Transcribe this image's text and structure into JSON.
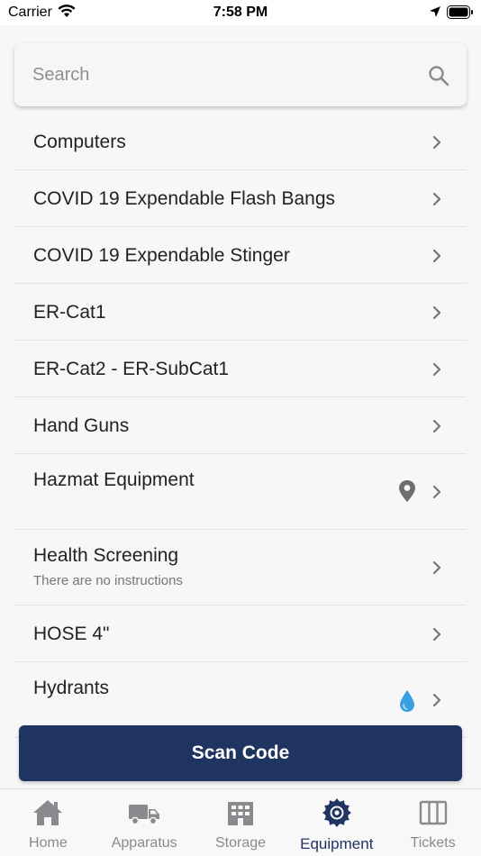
{
  "status_bar": {
    "carrier": "Carrier",
    "time": "7:58 PM"
  },
  "search": {
    "placeholder": "Search",
    "value": ""
  },
  "list": [
    {
      "label": "Computers"
    },
    {
      "label": "COVID 19 Expendable Flash Bangs"
    },
    {
      "label": "COVID 19 Expendable Stinger"
    },
    {
      "label": "ER-Cat1"
    },
    {
      "label": "ER-Cat2 - ER-SubCat1"
    },
    {
      "label": "Hand Guns"
    },
    {
      "label": "Hazmat Equipment",
      "icon": "location-pin-icon"
    },
    {
      "label": "Health Screening",
      "subtitle": "There are no instructions"
    },
    {
      "label": "HOSE 4\""
    },
    {
      "label": "Hydrants",
      "icon": "water-drop-icon"
    }
  ],
  "scan_button": {
    "label": "Scan Code"
  },
  "tabs": [
    {
      "label": "Home",
      "icon": "home-icon"
    },
    {
      "label": "Apparatus",
      "icon": "truck-icon"
    },
    {
      "label": "Storage",
      "icon": "building-icon"
    },
    {
      "label": "Equipment",
      "icon": "saw-blade-icon",
      "active": true
    },
    {
      "label": "Tickets",
      "icon": "columns-icon"
    }
  ],
  "colors": {
    "accent": "#1f3460",
    "inactive_tab": "#8a8a8e",
    "water_drop": "#3a9fe0"
  }
}
